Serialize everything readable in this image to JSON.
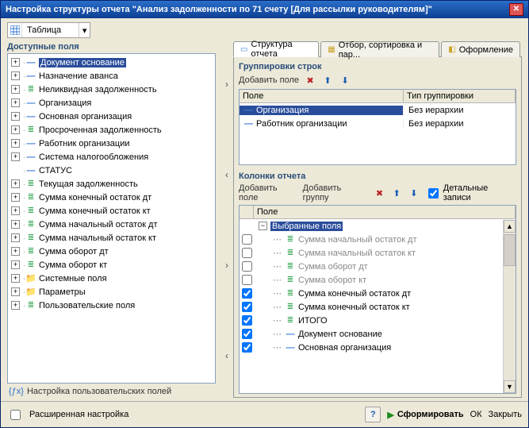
{
  "window": {
    "title": "Настройка структуры отчета \"Анализ задолженности по 71 счету [Для рассылки руководителям]\""
  },
  "combo": {
    "label": "Таблица"
  },
  "left": {
    "header": "Доступные поля",
    "user_settings": "Настройка пользовательских полей",
    "fields": [
      {
        "label": "Документ основание",
        "icon": "—",
        "iconClass": "iblue",
        "exp": "plus",
        "selected": true
      },
      {
        "label": "Назначение аванса",
        "icon": "—",
        "iconClass": "iblue",
        "exp": "plus"
      },
      {
        "label": "Неликвидная задолженность",
        "icon": "≣",
        "iconClass": "igreen",
        "exp": "plus"
      },
      {
        "label": "Организация",
        "icon": "—",
        "iconClass": "iblue",
        "exp": "plus"
      },
      {
        "label": "Основная организация",
        "icon": "—",
        "iconClass": "iblue",
        "exp": "plus"
      },
      {
        "label": "Просроченная задолженность",
        "icon": "≣",
        "iconClass": "igreen",
        "exp": "plus"
      },
      {
        "label": "Работник организации",
        "icon": "—",
        "iconClass": "iblue",
        "exp": "plus"
      },
      {
        "label": "Система налогообложения",
        "icon": "—",
        "iconClass": "iblue",
        "exp": "plus"
      },
      {
        "label": "СТАТУС",
        "icon": "—",
        "iconClass": "iblue",
        "exp": "none"
      },
      {
        "label": "Текущая задолженность",
        "icon": "≣",
        "iconClass": "igreen",
        "exp": "plus"
      },
      {
        "label": "Сумма конечный остаток дт",
        "icon": "≣",
        "iconClass": "igreen",
        "exp": "plus"
      },
      {
        "label": "Сумма конечный остаток кт",
        "icon": "≣",
        "iconClass": "igreen",
        "exp": "plus"
      },
      {
        "label": "Сумма начальный остаток дт",
        "icon": "≣",
        "iconClass": "igreen",
        "exp": "plus"
      },
      {
        "label": "Сумма начальный остаток кт",
        "icon": "≣",
        "iconClass": "igreen",
        "exp": "plus"
      },
      {
        "label": "Сумма оборот дт",
        "icon": "≣",
        "iconClass": "igreen",
        "exp": "plus"
      },
      {
        "label": "Сумма оборот кт",
        "icon": "≣",
        "iconClass": "igreen",
        "exp": "plus"
      },
      {
        "label": "Системные поля",
        "icon": "📁",
        "iconClass": "ifolder",
        "exp": "plus"
      },
      {
        "label": "Параметры",
        "icon": "📁",
        "iconClass": "ifolder",
        "exp": "plus"
      },
      {
        "label": "Пользовательские поля",
        "icon": "≣",
        "iconClass": "igreen",
        "exp": "plus"
      }
    ]
  },
  "tabs": {
    "t1": "Структура отчета",
    "t2": "Отбор, сортировка и пар...",
    "t3": "Оформление"
  },
  "rowgroups": {
    "header": "Группировки строк",
    "add": "Добавить поле",
    "col1": "Поле",
    "col2": "Тип группировки",
    "rows": [
      {
        "field": "Организация",
        "type": "Без иерархии",
        "selected": true
      },
      {
        "field": "Работник организации",
        "type": "Без иерархии"
      }
    ]
  },
  "cols": {
    "header": "Колонки отчета",
    "add_field": "Добавить поле",
    "add_group": "Добавить группу",
    "details": "Детальные записи",
    "col_field": "Поле",
    "root": "Выбранные поля",
    "rows": [
      {
        "label": "Сумма начальный остаток дт",
        "checked": false,
        "icon": "≣",
        "iconClass": "igreen"
      },
      {
        "label": "Сумма начальный остаток кт",
        "checked": false,
        "icon": "≣",
        "iconClass": "igreen"
      },
      {
        "label": "Сумма оборот дт",
        "checked": false,
        "icon": "≣",
        "iconClass": "igreen"
      },
      {
        "label": "Сумма оборот кт",
        "checked": false,
        "icon": "≣",
        "iconClass": "igreen"
      },
      {
        "label": "Сумма конечный остаток дт",
        "checked": true,
        "icon": "≣",
        "iconClass": "igreen"
      },
      {
        "label": "Сумма конечный остаток кт",
        "checked": true,
        "icon": "≣",
        "iconClass": "igreen"
      },
      {
        "label": "ИТОГО",
        "checked": true,
        "icon": "≣",
        "iconClass": "igreen"
      },
      {
        "label": "Документ основание",
        "checked": true,
        "icon": "—",
        "iconClass": "iblue"
      },
      {
        "label": "Основная организация",
        "checked": true,
        "icon": "—",
        "iconClass": "iblue"
      }
    ]
  },
  "bottom": {
    "advanced": "Расширенная настройка",
    "generate": "Сформировать",
    "ok": "ОК",
    "close": "Закрыть"
  }
}
